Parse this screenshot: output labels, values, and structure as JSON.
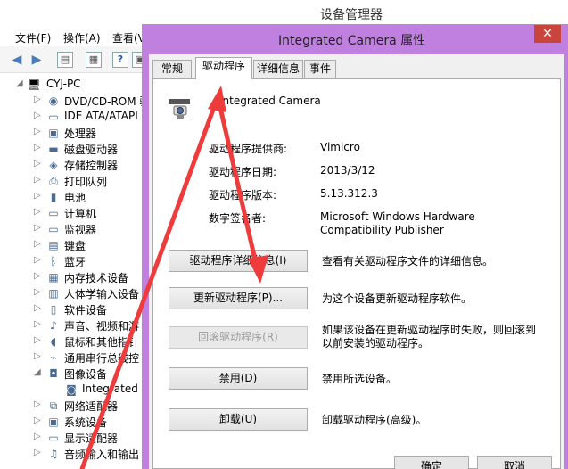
{
  "device_manager": {
    "title": "设备管理器",
    "menu": [
      "文件(F)",
      "操作(A)",
      "查看(V"
    ],
    "tree": {
      "root": "CYJ-PC",
      "items": [
        {
          "label": "DVD/CD-ROM 驱",
          "icon": "dvd-drive-icon"
        },
        {
          "label": "IDE ATA/ATAPI",
          "icon": "ide-controller-icon"
        },
        {
          "label": "处理器",
          "icon": "processor-icon"
        },
        {
          "label": "磁盘驱动器",
          "icon": "disk-drive-icon"
        },
        {
          "label": "存储控制器",
          "icon": "storage-controller-icon"
        },
        {
          "label": "打印队列",
          "icon": "printer-icon"
        },
        {
          "label": "电池",
          "icon": "battery-icon"
        },
        {
          "label": "计算机",
          "icon": "computer-icon"
        },
        {
          "label": "监视器",
          "icon": "monitor-icon"
        },
        {
          "label": "键盘",
          "icon": "keyboard-icon"
        },
        {
          "label": "蓝牙",
          "icon": "bluetooth-icon"
        },
        {
          "label": "内存技术设备",
          "icon": "memory-device-icon"
        },
        {
          "label": "人体学输入设备",
          "icon": "hid-icon"
        },
        {
          "label": "软件设备",
          "icon": "software-device-icon"
        },
        {
          "label": "声音、视频和游",
          "icon": "sound-icon"
        },
        {
          "label": "鼠标和其他指针",
          "icon": "mouse-icon"
        },
        {
          "label": "通用串行总线控",
          "icon": "usb-icon"
        },
        {
          "label": "图像设备",
          "icon": "imaging-device-icon"
        },
        {
          "label": "Integrated C",
          "icon": "camera-icon"
        },
        {
          "label": "网络适配器",
          "icon": "network-adapter-icon"
        },
        {
          "label": "系统设备",
          "icon": "system-device-icon"
        },
        {
          "label": "显示适配器",
          "icon": "display-adapter-icon"
        },
        {
          "label": "音频输入和输出",
          "icon": "audio-io-icon"
        }
      ]
    }
  },
  "dialog": {
    "title": "Integrated Camera 属性",
    "close": "✕",
    "tabs": [
      "常规",
      "驱动程序",
      "详细信息",
      "事件"
    ],
    "device_name": "Integrated Camera",
    "info": [
      {
        "label": "驱动程序提供商:",
        "value": "Vimicro"
      },
      {
        "label": "驱动程序日期:",
        "value": "2013/3/12"
      },
      {
        "label": "驱动程序版本:",
        "value": "5.13.312.3"
      },
      {
        "label": "数字签名者:",
        "value": "Microsoft Windows Hardware Compatibility Publisher"
      }
    ],
    "actions": [
      {
        "button": "驱动程序详细信息(I)",
        "desc": "查看有关驱动程序文件的详细信息。",
        "enabled": true
      },
      {
        "button": "更新驱动程序(P)...",
        "desc": "为这个设备更新驱动程序软件。",
        "enabled": true
      },
      {
        "button": "回滚驱动程序(R)",
        "desc": "如果该设备在更新驱动程序时失败，则回滚到以前安装的驱动程序。",
        "enabled": false
      },
      {
        "button": "禁用(D)",
        "desc": "禁用所选设备。",
        "enabled": true
      },
      {
        "button": "卸载(U)",
        "desc": "卸载驱动程序(高级)。",
        "enabled": true
      }
    ],
    "ok": "确定",
    "cancel": "取消"
  },
  "colors": {
    "dialog_frame": "#c080e0",
    "close_button": "#c8443c",
    "annotation_arrow": "#ee3b3b"
  }
}
